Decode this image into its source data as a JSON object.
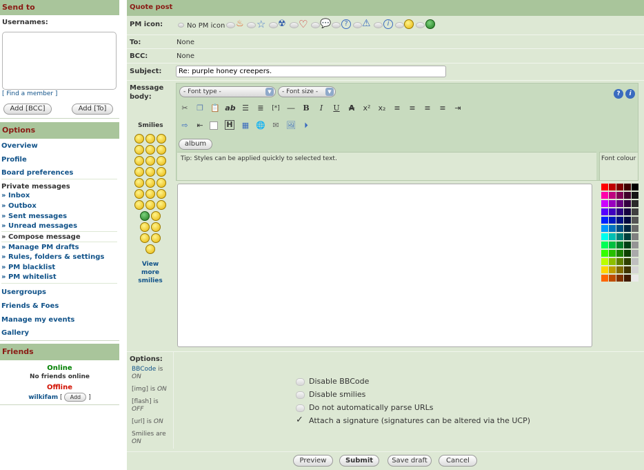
{
  "sidebar": {
    "send_to_title": "Send to",
    "usernames_label": "Usernames:",
    "find_member": "[ Find a member ]",
    "add_bcc": "Add [BCC]",
    "add_to": "Add [To]",
    "options_title": "Options",
    "nav": [
      {
        "label": "Overview"
      },
      {
        "label": "Profile"
      },
      {
        "label": "Board preferences"
      }
    ],
    "private_messages_label": "Private messages",
    "pm_items": [
      {
        "label": "Inbox"
      },
      {
        "label": "Outbox"
      },
      {
        "label": "Sent messages"
      },
      {
        "label": "Unread messages"
      }
    ],
    "compose_label": "Compose message",
    "pm_items2": [
      {
        "label": "Manage PM drafts"
      },
      {
        "label": "Rules, folders & settings"
      },
      {
        "label": "PM blacklist"
      },
      {
        "label": "PM whitelist"
      }
    ],
    "nav2": [
      {
        "label": "Usergroups"
      },
      {
        "label": "Friends & Foes"
      },
      {
        "label": "Manage my events"
      },
      {
        "label": "Gallery"
      }
    ],
    "friends_title": "Friends",
    "online_label": "Online",
    "no_friends": "No friends online",
    "offline_label": "Offline",
    "offline_friend": "wilkifam",
    "add_friend_btn": "Add",
    "bracket_open": "[",
    "bracket_close": "]",
    "online_color": "#008000",
    "offline_color": "#d21000"
  },
  "main": {
    "title": "Quote post",
    "pm_icon_label": "PM icon:",
    "no_pm_icon": "No PM icon",
    "pm_icons": [
      "flame-icon",
      "star-icon",
      "radioactive-icon",
      "heart-icon",
      "speech-bubble-icon",
      "question-icon",
      "warning-icon",
      "info-icon",
      "smiley-icon",
      "grin-icon"
    ],
    "to_label": "To:",
    "to_value": "None",
    "bcc_label": "BCC:",
    "bcc_value": "None",
    "subject_label": "Subject:",
    "subject_value": "Re: purple honey creepers.",
    "message_body_label": "Message body:",
    "smilies_label": "Smilies",
    "view_more_smilies": "View more smilies",
    "font_type": "- Font type -",
    "font_size": "- Font size -",
    "album_btn": "album",
    "tip": "Tip: Styles can be applied quickly to selected text.",
    "font_colour": "Font colour",
    "message_value": "",
    "options_label": "Options:",
    "status": {
      "bbcode_link": "BBCode",
      "bbcode_is": "is",
      "bbcode_state": "ON",
      "img_label": "[img] is",
      "img_state": "ON",
      "flash_label": "[flash] is",
      "flash_state": "OFF",
      "url_label": "[url] is",
      "url_state": "ON",
      "smilies_label": "Smilies are",
      "smilies_state": "ON"
    },
    "checkboxes": [
      {
        "label": "Disable BBCode",
        "checked": false
      },
      {
        "label": "Disable smilies",
        "checked": false
      },
      {
        "label": "Do not automatically parse URLs",
        "checked": false
      },
      {
        "label": "Attach a signature (signatures can be altered via the UCP)",
        "checked": true
      }
    ],
    "buttons": {
      "preview": "Preview",
      "submit": "Submit",
      "save_draft": "Save draft",
      "cancel": "Cancel"
    },
    "toolbar_row1": [
      "cut-icon",
      "copy-icon",
      "paste-icon",
      "ab-icon",
      "bullet-list-icon",
      "numbered-list-icon",
      "code-icon",
      "hr-icon",
      "bold-icon",
      "italic-icon",
      "underline-icon",
      "strike-icon",
      "superscript-icon",
      "subscript-icon",
      "align-justify-icon",
      "align-left-icon",
      "align-center-icon",
      "align-right-icon",
      "indent-icon"
    ],
    "toolbar_row2": [
      "exit-icon",
      "outdent-icon",
      "blank-icon",
      "heading-icon",
      "table-icon",
      "globe-link-icon",
      "email-icon",
      "image-icon",
      "flash-icon"
    ]
  },
  "colors": {
    "header_bg": "#a9c59b",
    "header_text": "#8a1a14",
    "panel_bg": "#dde8d4",
    "link": "#105289"
  }
}
